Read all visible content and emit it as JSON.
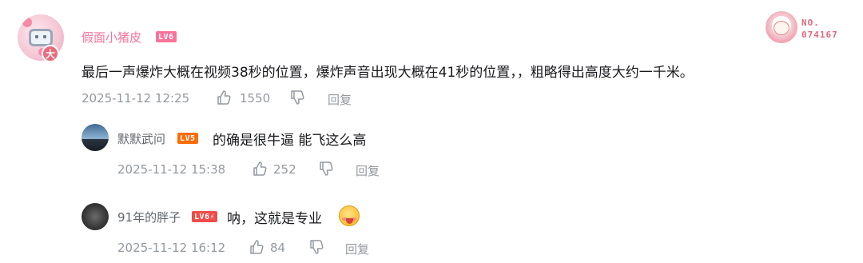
{
  "fan_badge": {
    "number": "NO.\n074167",
    "no_label": "NO.",
    "no_value": "074167"
  },
  "main_comment": {
    "username": "假面小猪皮",
    "level": "LV6",
    "avatar_badge": "大",
    "text": "最后一声爆炸大概在视频38秒的位置，爆炸声音出现大概在41秒的位置，，粗略得出高度大约一千米。",
    "time": "2025-11-12 12:25",
    "likes": "1550",
    "reply_label": "回复"
  },
  "replies": [
    {
      "username": "默默武问",
      "level": "LV5",
      "text": "的确是很牛逼 能飞这么高",
      "time": "2025-11-12 15:38",
      "likes": "252",
      "reply_label": "回复"
    },
    {
      "username": "91年的胖子",
      "level": "LV6⚡",
      "text": "呐，这就是专业",
      "time": "2025-11-12 16:12",
      "likes": "84",
      "reply_label": "回复"
    }
  ],
  "colors": {
    "accent": "#fb7299",
    "meta": "#9499a0",
    "text": "#18191c"
  }
}
